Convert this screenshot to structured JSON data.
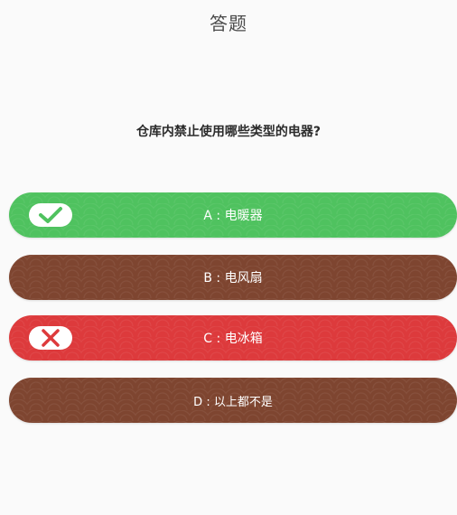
{
  "header": {
    "title": "答题"
  },
  "question": {
    "text": "仓库内禁止使用哪些类型的电器?"
  },
  "options": [
    {
      "label": "A : 电暖器",
      "state": "correct",
      "color": "#4fc25f",
      "icon": "check-icon"
    },
    {
      "label": "B : 电风扇",
      "state": "neutral",
      "color": "#7e4530"
    },
    {
      "label": "C : 电冰箱",
      "state": "wrong",
      "color": "#dd3a3c",
      "icon": "close-icon"
    },
    {
      "label": "D : 以上都不是",
      "state": "neutral",
      "color": "#7e4530"
    }
  ]
}
